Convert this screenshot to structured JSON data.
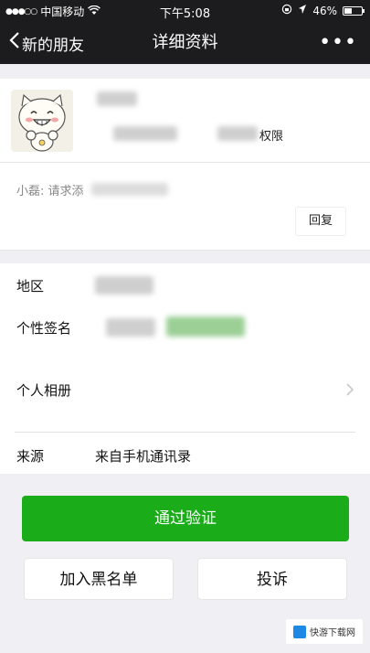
{
  "status_bar": {
    "signal_dots": "●●●○○",
    "carrier": "中国移动",
    "wifi_icon": "wifi-icon",
    "time": "下午5:08",
    "battery_percent": "46%",
    "battery_level": 0.46
  },
  "nav": {
    "back_label": "新的朋友",
    "title": "详细资料",
    "more_label": "•••"
  },
  "profile": {
    "permission_suffix": "权限"
  },
  "greeting": {
    "message": "小磊: 请求添",
    "reply_label": "回复"
  },
  "info": {
    "region_label": "地区",
    "signature_label": "个性签名",
    "album_label": "个人相册",
    "source_label": "来源",
    "source_value": "来自手机通讯录"
  },
  "actions": {
    "verify_label": "通过验证",
    "blacklist_label": "加入黑名单",
    "report_label": "投诉"
  },
  "watermark": {
    "text": "快游下载网"
  },
  "colors": {
    "accent_green": "#1aad19",
    "navbar_bg": "#1c1c1e",
    "page_bg": "#efeff4"
  }
}
